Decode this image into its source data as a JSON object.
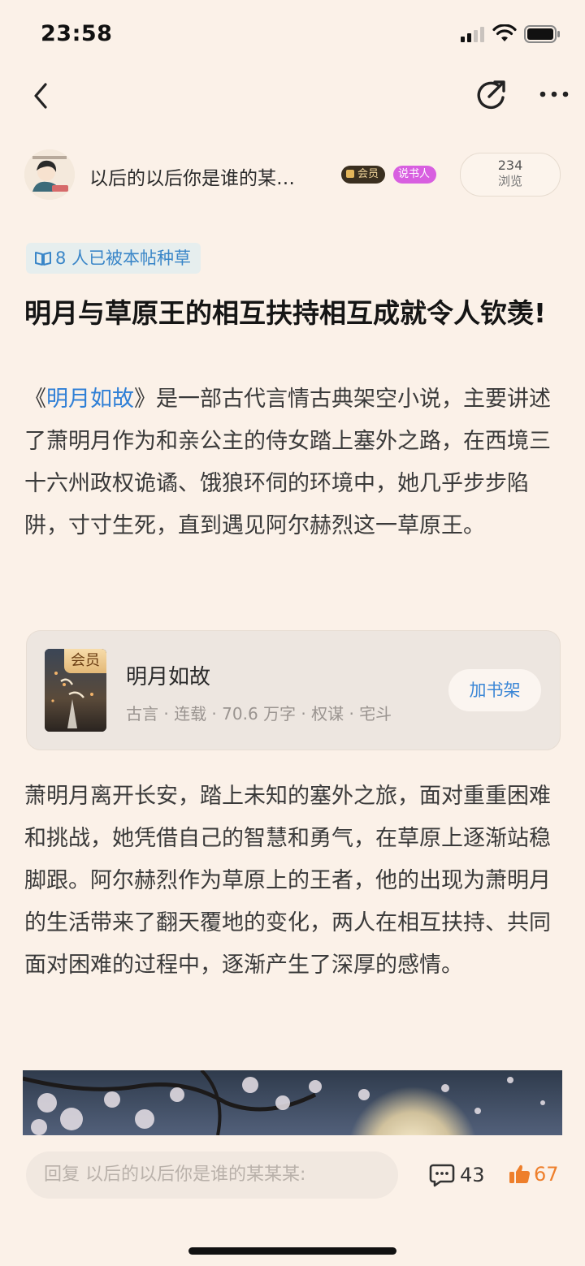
{
  "status_bar": {
    "time": "23:58"
  },
  "author": {
    "name": "以后的以后你是谁的某…",
    "badge_vip": "会员",
    "badge_storyteller": "说书人",
    "views_count": "234",
    "views_label": "浏览"
  },
  "seeded_tag": "8 人已被本帖种草",
  "post": {
    "title": "明月与草原王的相互扶持相互成就令人钦羡!",
    "para1_prefix": "《",
    "para1_book_link": "明月如故",
    "para1_rest": "》是一部古代言情古典架空小说，主要讲述了萧明月作为和亲公主的侍女踏上塞外之路，在西境三十六州政权诡谲、饿狼环伺的环境中，她几乎步步陷阱，寸寸生死，直到遇见阿尔赫烈这一草原王。",
    "para2": "萧明月离开长安，踏上未知的塞外之旅，面对重重困难和挑战，她凭借自己的智慧和勇气，在草原上逐渐站稳脚跟。阿尔赫烈作为草原上的王者，他的出现为萧明月的生活带来了翻天覆地的变化，两人在相互扶持、共同面对困难的过程中，逐渐产生了深厚的感情。"
  },
  "book_card": {
    "cover_badge": "会员",
    "title": "明月如故",
    "meta": "古言 · 连载 · 70.6 万字 · 权谋 · 宅斗",
    "add_button": "加书架"
  },
  "bottom_bar": {
    "reply_placeholder": "回复 以后的以后你是谁的某某某:",
    "comment_count": "43",
    "like_count": "67"
  },
  "colors": {
    "background": "#FBF1E8",
    "link": "#2f7fd6",
    "like": "#ee7f2b"
  }
}
